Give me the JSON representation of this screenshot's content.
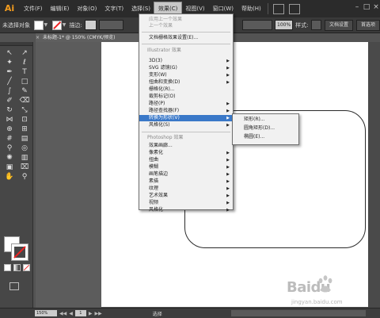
{
  "app": {
    "logo": "Ai"
  },
  "menubar": {
    "items": [
      "文件(F)",
      "编辑(E)",
      "对象(O)",
      "文字(T)",
      "选择(S)",
      "效果(C)",
      "视图(V)",
      "窗口(W)",
      "帮助(H)"
    ],
    "active_index": 5
  },
  "control_bar": {
    "selection_label": "未选择对象",
    "stroke_label": "描边:",
    "opacity_value": "100%",
    "style_label": "样式:",
    "doc_setup_button": "文档设置",
    "prefs_button": "首选项"
  },
  "document": {
    "tab_title": "未标题-1* @ 150% (CMYK/预览)"
  },
  "effect_menu": {
    "apply_last": "应用上一个效果",
    "last_effect": "上一个效果",
    "document_raster": "文档栅格效果设置(E)...",
    "illustrator_header": "Illustrator 效果",
    "illustrator_items": [
      "3D(3)",
      "SVG 滤镜(G)",
      "变形(W)",
      "扭曲和变换(D)",
      "栅格化(R)...",
      "裁剪标记(O)",
      "路径(P)",
      "路径查找器(F)",
      "转换为形状(V)",
      "风格化(S)"
    ],
    "highlighted": "转换为形状(V)",
    "photoshop_header": "Photoshop 效果",
    "photoshop_items": [
      "效果画廊...",
      "像素化",
      "扭曲",
      "模糊",
      "画笔描边",
      "素描",
      "纹理",
      "艺术效果",
      "视频",
      "风格化"
    ]
  },
  "convert_submenu": {
    "items": [
      "矩形(R)...",
      "圆角矩形(D)...",
      "椭圆(E)..."
    ]
  },
  "status_bar": {
    "zoom": "150%",
    "page": "1",
    "tool_text": "选择"
  },
  "watermark": {
    "brand": "Baidu",
    "url": "jingyan.baidu.com"
  },
  "colors": {
    "menu_highlight": "#3a78c8",
    "logo_orange": "#f39c1e",
    "none_red": "#e22222"
  },
  "tools": [
    "selection-tool",
    "direct-selection-tool",
    "magic-wand-tool",
    "lasso-tool",
    "pen-tool",
    "type-tool",
    "line-tool",
    "rectangle-tool",
    "paintbrush-tool",
    "pencil-tool",
    "blob-brush-tool",
    "eraser-tool",
    "rotate-tool",
    "scale-tool",
    "width-tool",
    "free-transform-tool",
    "shape-builder-tool",
    "perspective-grid-tool",
    "mesh-tool",
    "gradient-tool",
    "eyedropper-tool",
    "blend-tool",
    "symbol-sprayer-tool",
    "column-graph-tool",
    "artboard-tool",
    "slice-tool",
    "hand-tool",
    "zoom-tool"
  ]
}
